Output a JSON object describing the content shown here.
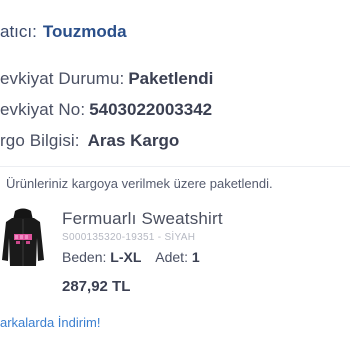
{
  "seller": {
    "label": "atıcı:",
    "name": "Touzmoda"
  },
  "shipment": {
    "status_label": "evkiyat Durumu:",
    "status_value": "Paketlendi",
    "number_label": "evkiyat No:",
    "number_value": "5403022003342",
    "cargo_label": "rgo Bilgisi:",
    "cargo_value": "Aras Kargo"
  },
  "status_message": "Ürünleriniz kargoya verilmek üzere paketlendi.",
  "product": {
    "name": "Fermuarlı Sweatshirt",
    "code": "S000135320-19351 - SİYAH",
    "size_label": "Beden:",
    "size_value": "L-XL",
    "qty_label": "Adet:",
    "qty_value": "1",
    "price": "287,92 TL",
    "image_icon": "black-zip-hoodie-image"
  },
  "promo_link": "arkalarda İndirim!",
  "colors": {
    "link_blue": "#3a7fd0",
    "seller_blue": "#2a4f8a",
    "text_dark": "#3a3f51"
  }
}
